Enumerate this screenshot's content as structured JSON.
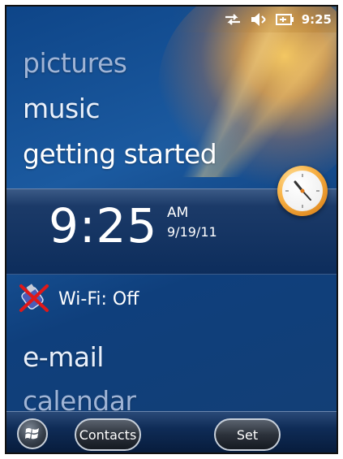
{
  "statusbar": {
    "sync_icon": "data-sync-icon",
    "volume_icon": "speaker-muted-icon",
    "battery_icon": "battery-charging-icon",
    "time": "9:25"
  },
  "home": {
    "items": [
      {
        "label": "pictures"
      },
      {
        "label": "music"
      },
      {
        "label": "getting started"
      }
    ],
    "clock": {
      "time": "9:25",
      "ampm": "AM",
      "date": "9/19/11",
      "icon": "analog-clock-icon"
    },
    "wifi": {
      "icon": "wifi-disabled-icon",
      "label": "Wi-Fi: Off"
    },
    "lower_items": [
      {
        "label": "e-mail"
      },
      {
        "label": "calendar"
      }
    ]
  },
  "softkeys": {
    "start_icon": "windows-start-icon",
    "left_label": "Contacts",
    "right_label": "Set"
  },
  "colors": {
    "accent_clock": "#f9b54a",
    "background": "#1b5aa0"
  }
}
